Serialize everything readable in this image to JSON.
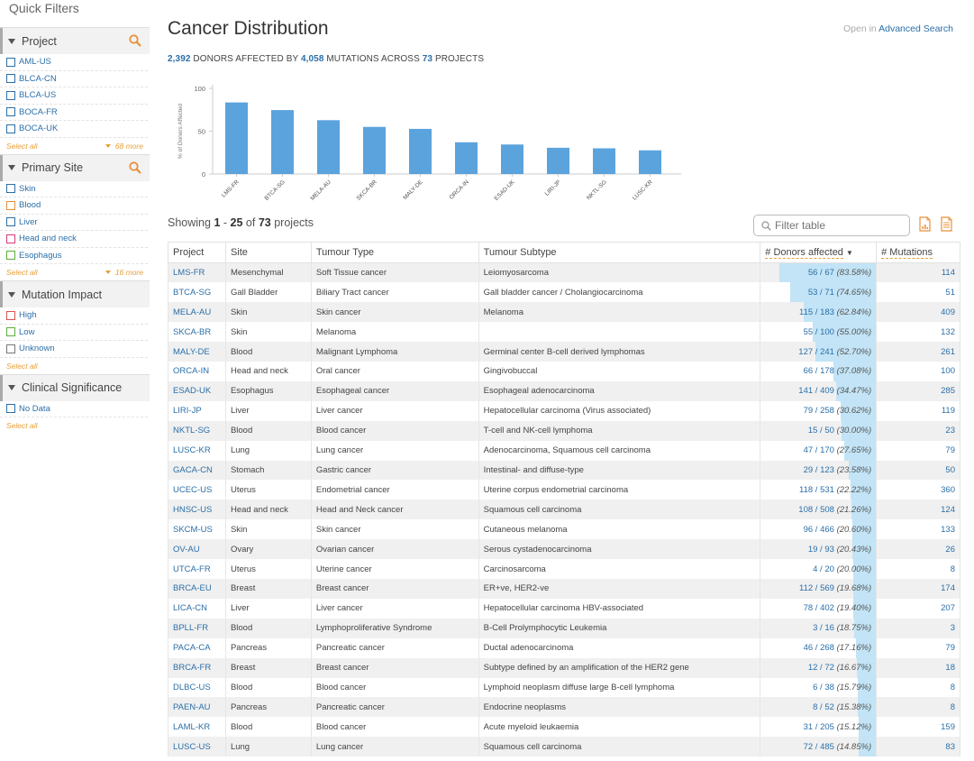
{
  "sidebar": {
    "title": "Quick Filters",
    "facets": [
      {
        "label": "Project",
        "searchable": true,
        "box_color": "#2b6fa8",
        "terms": [
          "AML-US",
          "BLCA-CN",
          "BLCA-US",
          "BOCA-FR",
          "BOCA-UK"
        ],
        "select_all": "Select all",
        "more": "68 more"
      },
      {
        "label": "Primary Site",
        "searchable": true,
        "terms": [
          {
            "label": "Skin",
            "color": "#2b6fa8"
          },
          {
            "label": "Blood",
            "color": "#e8903a"
          },
          {
            "label": "Liver",
            "color": "#2b6fa8"
          },
          {
            "label": "Head and neck",
            "color": "#d63a7a"
          },
          {
            "label": "Esophagus",
            "color": "#5aae3a"
          }
        ],
        "select_all": "Select all",
        "more": "16 more"
      },
      {
        "label": "Mutation Impact",
        "searchable": false,
        "terms": [
          {
            "label": "High",
            "color": "#d9534f"
          },
          {
            "label": "Low",
            "color": "#5aae3a"
          },
          {
            "label": "Unknown",
            "color": "#777777"
          }
        ],
        "select_all": "Select all",
        "more": ""
      },
      {
        "label": "Clinical Significance",
        "searchable": false,
        "terms": [
          {
            "label": "No Data",
            "color": "#2b6fa8"
          }
        ],
        "select_all": "Select all",
        "more": ""
      }
    ]
  },
  "main": {
    "title": "Cancer Distribution",
    "adv_prefix": "Open in",
    "adv_link": "Advanced Search",
    "summary": {
      "donors": "2,392",
      "t1": "DONORS AFFECTED BY",
      "mutations": "4,058",
      "t2": "MUTATIONS ACROSS",
      "projects": "73",
      "t3": "PROJECTS"
    },
    "showing": {
      "prefix": "Showing",
      "from": "1",
      "sep": "-",
      "to": "25",
      "of": "of",
      "total": "73",
      "suffix": "projects"
    },
    "filter_placeholder": "Filter table",
    "columns": [
      "Project",
      "Site",
      "Tumour Type",
      "Tumour Subtype",
      "# Donors affected",
      "# Mutations"
    ],
    "sort_indicator": "▼"
  },
  "chart_data": {
    "type": "bar",
    "ylabel": "% of Donors Affected",
    "ylim": [
      0,
      100
    ],
    "yticks": [
      0,
      50,
      100
    ],
    "bar_color": "#5ba3dd",
    "categories": [
      "LMS-FR",
      "BTCA-SG",
      "MELA-AU",
      "SKCA-BR",
      "MALY-DE",
      "ORCA-IN",
      "ESAD-UK",
      "LIRI-JP",
      "NKTL-SG",
      "LUSC-KR"
    ],
    "values": [
      83.58,
      74.65,
      62.84,
      55.0,
      52.7,
      37.08,
      34.47,
      30.62,
      30.0,
      27.65
    ]
  },
  "table": {
    "rows": [
      {
        "project": "LMS-FR",
        "site": "Mesenchymal",
        "type": "Soft Tissue cancer",
        "subtype": "Leiomyosarcoma",
        "affected": "56",
        "total": "67",
        "pct": "(83.58%)",
        "frac": 0.8358,
        "mutations": "114"
      },
      {
        "project": "BTCA-SG",
        "site": "Gall Bladder",
        "type": "Biliary Tract cancer",
        "subtype": "Gall bladder cancer / Cholangiocarcinoma",
        "affected": "53",
        "total": "71",
        "pct": "(74.65%)",
        "frac": 0.7465,
        "mutations": "51"
      },
      {
        "project": "MELA-AU",
        "site": "Skin",
        "type": "Skin cancer",
        "subtype": "Melanoma",
        "affected": "115",
        "total": "183",
        "pct": "(62.84%)",
        "frac": 0.6284,
        "mutations": "409"
      },
      {
        "project": "SKCA-BR",
        "site": "Skin",
        "type": "Melanoma",
        "subtype": "",
        "affected": "55",
        "total": "100",
        "pct": "(55.00%)",
        "frac": 0.55,
        "mutations": "132"
      },
      {
        "project": "MALY-DE",
        "site": "Blood",
        "type": "Malignant Lymphoma",
        "subtype": "Germinal center B-cell derived lymphomas",
        "affected": "127",
        "total": "241",
        "pct": "(52.70%)",
        "frac": 0.527,
        "mutations": "261"
      },
      {
        "project": "ORCA-IN",
        "site": "Head and neck",
        "type": "Oral cancer",
        "subtype": "Gingivobuccal",
        "affected": "66",
        "total": "178",
        "pct": "(37.08%)",
        "frac": 0.3708,
        "mutations": "100"
      },
      {
        "project": "ESAD-UK",
        "site": "Esophagus",
        "type": "Esophageal cancer",
        "subtype": "Esophageal adenocarcinoma",
        "affected": "141",
        "total": "409",
        "pct": "(34.47%)",
        "frac": 0.3447,
        "mutations": "285"
      },
      {
        "project": "LIRI-JP",
        "site": "Liver",
        "type": "Liver cancer",
        "subtype": "Hepatocellular carcinoma (Virus associated)",
        "affected": "79",
        "total": "258",
        "pct": "(30.62%)",
        "frac": 0.3062,
        "mutations": "119"
      },
      {
        "project": "NKTL-SG",
        "site": "Blood",
        "type": "Blood cancer",
        "subtype": "T-cell and NK-cell lymphoma",
        "affected": "15",
        "total": "50",
        "pct": "(30.00%)",
        "frac": 0.3,
        "mutations": "23"
      },
      {
        "project": "LUSC-KR",
        "site": "Lung",
        "type": "Lung cancer",
        "subtype": "Adenocarcinoma, Squamous cell carcinoma",
        "affected": "47",
        "total": "170",
        "pct": "(27.65%)",
        "frac": 0.2765,
        "mutations": "79"
      },
      {
        "project": "GACA-CN",
        "site": "Stomach",
        "type": "Gastric cancer",
        "subtype": "Intestinal- and diffuse-type",
        "affected": "29",
        "total": "123",
        "pct": "(23.58%)",
        "frac": 0.2358,
        "mutations": "50"
      },
      {
        "project": "UCEC-US",
        "site": "Uterus",
        "type": "Endometrial cancer",
        "subtype": "Uterine corpus endometrial carcinoma",
        "affected": "118",
        "total": "531",
        "pct": "(22.22%)",
        "frac": 0.2222,
        "mutations": "360"
      },
      {
        "project": "HNSC-US",
        "site": "Head and neck",
        "type": "Head and Neck cancer",
        "subtype": "Squamous cell carcinoma",
        "affected": "108",
        "total": "508",
        "pct": "(21.26%)",
        "frac": 0.2126,
        "mutations": "124"
      },
      {
        "project": "SKCM-US",
        "site": "Skin",
        "type": "Skin cancer",
        "subtype": "Cutaneous melanoma",
        "affected": "96",
        "total": "466",
        "pct": "(20.60%)",
        "frac": 0.206,
        "mutations": "133"
      },
      {
        "project": "OV-AU",
        "site": "Ovary",
        "type": "Ovarian cancer",
        "subtype": "Serous cystadenocarcinoma",
        "affected": "19",
        "total": "93",
        "pct": "(20.43%)",
        "frac": 0.2043,
        "mutations": "26"
      },
      {
        "project": "UTCA-FR",
        "site": "Uterus",
        "type": "Uterine cancer",
        "subtype": "Carcinosarcoma",
        "affected": "4",
        "total": "20",
        "pct": "(20.00%)",
        "frac": 0.2,
        "mutations": "8"
      },
      {
        "project": "BRCA-EU",
        "site": "Breast",
        "type": "Breast cancer",
        "subtype": "ER+ve, HER2-ve",
        "affected": "112",
        "total": "569",
        "pct": "(19.68%)",
        "frac": 0.1968,
        "mutations": "174"
      },
      {
        "project": "LICA-CN",
        "site": "Liver",
        "type": "Liver cancer",
        "subtype": "Hepatocellular carcinoma HBV-associated",
        "affected": "78",
        "total": "402",
        "pct": "(19.40%)",
        "frac": 0.194,
        "mutations": "207"
      },
      {
        "project": "BPLL-FR",
        "site": "Blood",
        "type": "Lymphoproliferative Syndrome",
        "subtype": "B-Cell Prolymphocytic Leukemia",
        "affected": "3",
        "total": "16",
        "pct": "(18.75%)",
        "frac": 0.1875,
        "mutations": "3"
      },
      {
        "project": "PACA-CA",
        "site": "Pancreas",
        "type": "Pancreatic cancer",
        "subtype": "Ductal adenocarcinoma",
        "affected": "46",
        "total": "268",
        "pct": "(17.16%)",
        "frac": 0.1716,
        "mutations": "79"
      },
      {
        "project": "BRCA-FR",
        "site": "Breast",
        "type": "Breast cancer",
        "subtype": "Subtype defined by an amplification of the HER2 gene",
        "affected": "12",
        "total": "72",
        "pct": "(16.67%)",
        "frac": 0.1667,
        "mutations": "18"
      },
      {
        "project": "DLBC-US",
        "site": "Blood",
        "type": "Blood cancer",
        "subtype": "Lymphoid neoplasm diffuse large B-cell lymphoma",
        "affected": "6",
        "total": "38",
        "pct": "(15.79%)",
        "frac": 0.1579,
        "mutations": "8"
      },
      {
        "project": "PAEN-AU",
        "site": "Pancreas",
        "type": "Pancreatic cancer",
        "subtype": "Endocrine neoplasms",
        "affected": "8",
        "total": "52",
        "pct": "(15.38%)",
        "frac": 0.1538,
        "mutations": "8"
      },
      {
        "project": "LAML-KR",
        "site": "Blood",
        "type": "Blood cancer",
        "subtype": "Acute myeloid leukaemia",
        "affected": "31",
        "total": "205",
        "pct": "(15.12%)",
        "frac": 0.1512,
        "mutations": "159"
      },
      {
        "project": "LUSC-US",
        "site": "Lung",
        "type": "Lung cancer",
        "subtype": "Squamous cell carcinoma",
        "affected": "72",
        "total": "485",
        "pct": "(14.85%)",
        "frac": 0.1485,
        "mutations": "83"
      }
    ]
  }
}
